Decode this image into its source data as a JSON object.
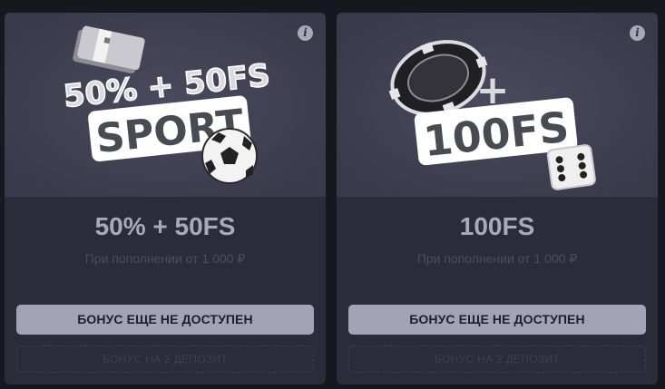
{
  "cards": [
    {
      "image_text_line1": "50% + 50FS",
      "image_text_line2": "SPORT",
      "image_icon": "soccer-ball-icon",
      "info_icon": "info-icon",
      "info_glyph": "i",
      "title": "50% + 50FS",
      "subtitle": "При пополнении от 1 000 ₽",
      "button_label": "БОНУС ЕЩЕ НЕ ДОСТУПЕН",
      "secondary_label": "БОНУС НА 2 ДЕПОЗИТ"
    },
    {
      "image_text_line1": "+",
      "image_text_line2": "100FS",
      "image_icon": "dice-icon",
      "info_icon": "info-icon",
      "info_glyph": "i",
      "title": "100FS",
      "subtitle": "При пополнении от 1 000 ₽",
      "button_label": "БОНУС ЕЩЕ НЕ ДОСТУПЕН",
      "secondary_label": "БОНУС НА 2 ДЕПОЗИТ"
    }
  ],
  "colors": {
    "page_bg": "#17171f",
    "card_bg": "#2b2b39",
    "image_bg": "#3a3a4c",
    "title": "#a9a9b9",
    "button_bg": "#a3a3b7"
  }
}
